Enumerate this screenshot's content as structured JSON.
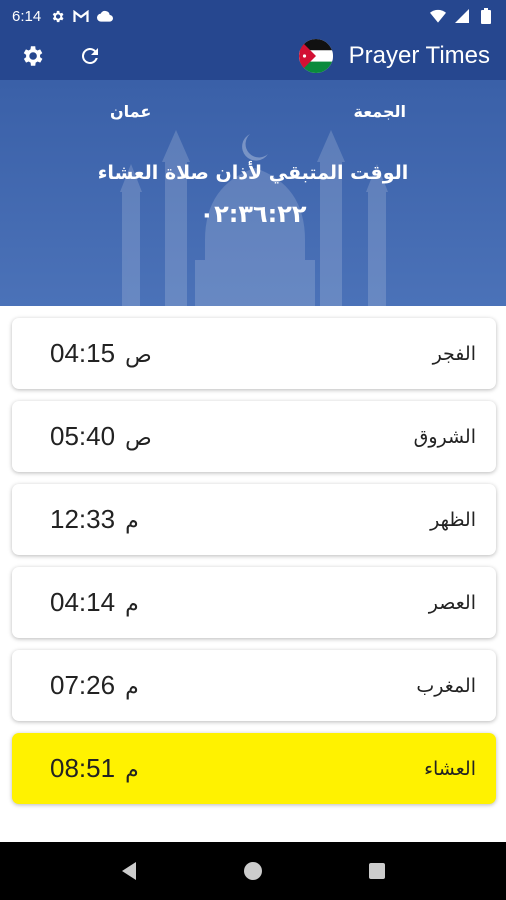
{
  "status_bar": {
    "time": "6:14",
    "left_icons": [
      "gear-icon",
      "gmail-icon",
      "cloud-icon"
    ],
    "right_icons": [
      "wifi-icon",
      "signal-icon",
      "battery-icon"
    ]
  },
  "app_bar": {
    "title": "Prayer Times",
    "settings_icon": "gear-icon",
    "refresh_icon": "refresh-icon",
    "flag": "jordan-flag-icon"
  },
  "banner": {
    "day": "الجمعة",
    "city": "عمان",
    "remaining_label": "الوقت المتبقي لأذان صلاة العشاء",
    "countdown": "٠٢:٣٦:٢٢"
  },
  "prayers": [
    {
      "name": "الفجر",
      "time": "04:15",
      "period": "ص",
      "active": false
    },
    {
      "name": "الشروق",
      "time": "05:40",
      "period": "ص",
      "active": false
    },
    {
      "name": "الظهر",
      "time": "12:33",
      "period": "م",
      "active": false
    },
    {
      "name": "العصر",
      "time": "04:14",
      "period": "م",
      "active": false
    },
    {
      "name": "المغرب",
      "time": "07:26",
      "period": "م",
      "active": false
    },
    {
      "name": "العشاء",
      "time": "08:51",
      "period": "م",
      "active": true
    }
  ],
  "colors": {
    "primary": "#26478f",
    "banner": "#4b72b8",
    "highlight": "#fff200"
  },
  "nav_bar": {
    "buttons": [
      "back-icon",
      "home-icon",
      "recents-icon"
    ]
  }
}
